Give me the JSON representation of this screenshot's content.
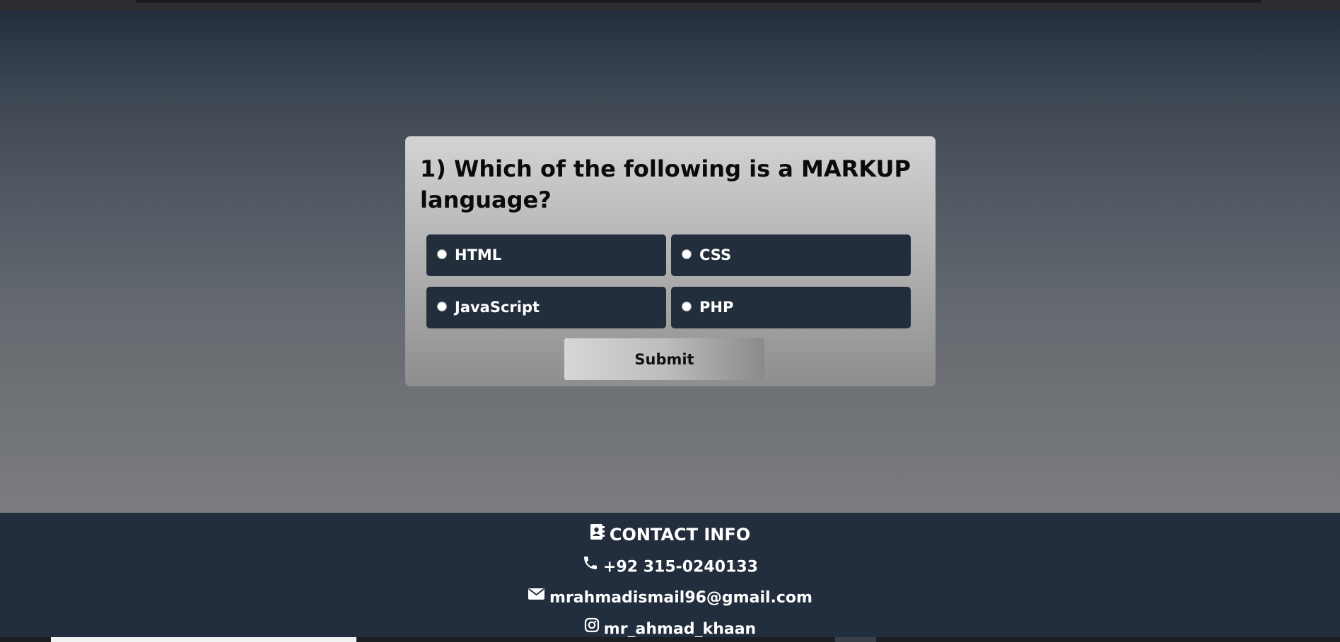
{
  "quiz": {
    "question": "1) Which of the following is a MARKUP language?",
    "options": [
      {
        "label": "HTML"
      },
      {
        "label": "CSS"
      },
      {
        "label": "JavaScript"
      },
      {
        "label": "PHP"
      }
    ],
    "submit_label": "Submit"
  },
  "footer": {
    "title": "CONTACT INFO",
    "phone": "+92 315-0240133",
    "email": "mrahmadismail96@gmail.com",
    "instagram": "mr_ahmad_khaan",
    "icons": {
      "title": "contact-book-icon",
      "phone": "phone-icon",
      "email": "envelope-icon",
      "instagram": "instagram-icon"
    }
  },
  "colors": {
    "option_bg": "#222e3c",
    "footer_bg": "#222e3d",
    "text_light": "#ffffff",
    "text_dark": "#0b0b0b"
  }
}
